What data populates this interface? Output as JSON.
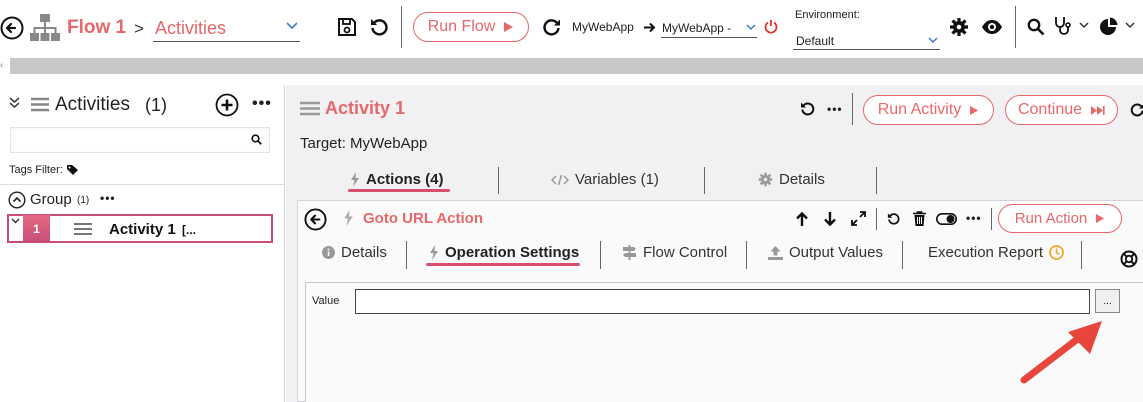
{
  "topbar": {
    "flow_title": "Flow 1",
    "breadcrumb_sep": ">",
    "section_select": "Activities",
    "run_flow_label": "Run Flow",
    "app_source": "MyWebApp",
    "app_target": "MyWebApp -",
    "environment_label": "Environment:",
    "environment_value": "Default"
  },
  "sidebar": {
    "title": "Activities",
    "count": "(1)",
    "search_placeholder": "",
    "tags_filter_label": "Tags Filter:",
    "group_label": "Group",
    "group_count": "(1)",
    "activity_index": "1",
    "activity_name": "Activity 1",
    "activity_suffix": "[..."
  },
  "activity": {
    "title": "Activity 1",
    "run_activity_label": "Run Activity",
    "continue_label": "Continue",
    "target_label": "Target: MyWebApp",
    "tabs": [
      {
        "label": "Actions (4)"
      },
      {
        "label": "Variables (1)"
      },
      {
        "label": "Details"
      }
    ]
  },
  "action": {
    "title": "Goto URL Action",
    "run_action_label": "Run Action",
    "tabs": [
      {
        "label": "Details"
      },
      {
        "label": "Operation Settings"
      },
      {
        "label": "Flow Control"
      },
      {
        "label": "Output Values"
      },
      {
        "label": "Execution Report"
      }
    ],
    "value_label": "Value",
    "value_input": "",
    "browse_label": "..."
  },
  "colors": {
    "accent": "#e8676a",
    "active_underline": "#d94f6b",
    "panel_bg": "#f1f1f4",
    "arrow": "#e8453c"
  }
}
